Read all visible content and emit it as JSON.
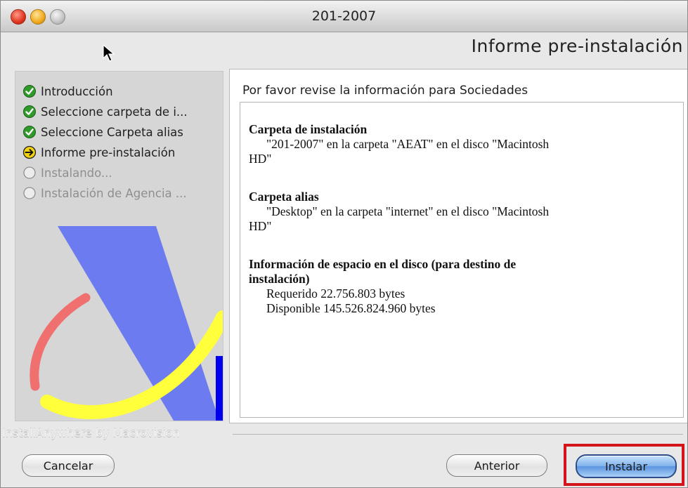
{
  "window": {
    "title": "201-2007"
  },
  "header": {
    "title": "Informe pre-instalación"
  },
  "steps": [
    {
      "label": "Introducción",
      "status": "done"
    },
    {
      "label": "Seleccione carpeta de i...",
      "status": "done"
    },
    {
      "label": "Seleccione  Carpeta alias",
      "status": "done"
    },
    {
      "label": "Informe pre-instalación",
      "status": "current"
    },
    {
      "label": "Instalando...",
      "status": "pending"
    },
    {
      "label": "Instalación de Agencia ...",
      "status": "pending"
    }
  ],
  "info": {
    "heading": "Por favor revise la información para Sociedades",
    "install_folder": {
      "title": "Carpeta de instalación",
      "line1": "\"201-2007\" en la carpeta \"AEAT\" en el disco \"Macintosh",
      "line2": "HD\""
    },
    "alias_folder": {
      "title": "Carpeta alias",
      "line1": "\"Desktop\" en la carpeta \"internet\" en el disco \"Macintosh",
      "line2": "HD\""
    },
    "disk_space": {
      "title_line1": "Información de espacio en el disco (para destino de",
      "title_line2": "instalación)",
      "required": "Requerido 22.756.803 bytes",
      "available": "Disponible 145.526.824.960 bytes"
    }
  },
  "branding": "InstallAnywhere by Macrovision",
  "buttons": {
    "cancel": "Cancelar",
    "back": "Anterior",
    "install": "Instalar"
  },
  "colors": {
    "done_icon": "#2f9a2a",
    "current_icon": "#f2d10f",
    "highlight": "#d3151b",
    "logo_blue": "#6c7cf0",
    "logo_yellow": "#ffff3c",
    "logo_red": "#f07070"
  },
  "icons": {
    "done": "checkmark-circle-icon",
    "current": "arrow-right-circle-icon",
    "pending": "empty-circle-icon"
  }
}
